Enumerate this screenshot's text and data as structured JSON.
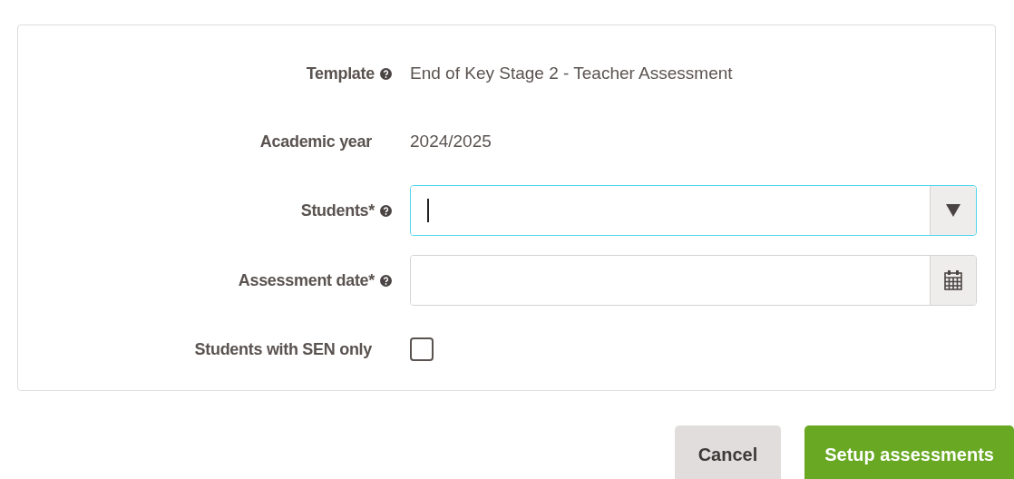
{
  "form": {
    "rows": [
      {
        "kind": "text",
        "label": "Template",
        "help": true,
        "value": "End of Key Stage 2 - Teacher Assessment"
      },
      {
        "kind": "text",
        "label": "Academic year",
        "help": false,
        "value": "2024/2025"
      },
      {
        "kind": "dropdown",
        "label": "Students*",
        "help": true,
        "focused": true
      },
      {
        "kind": "date",
        "label": "Assessment date*",
        "help": true,
        "focused": false
      },
      {
        "kind": "checkbox",
        "label": "Students with SEN only",
        "help": false,
        "checked": false
      }
    ]
  },
  "buttons": [
    {
      "kind": "secondary",
      "label": "Cancel"
    },
    {
      "kind": "primary",
      "label": "Setup assessments"
    }
  ]
}
